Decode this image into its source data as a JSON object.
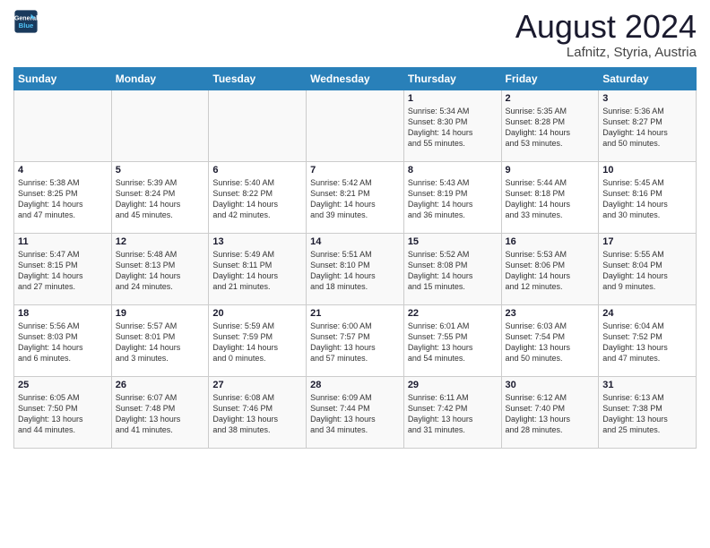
{
  "header": {
    "logo_line1": "General",
    "logo_line2": "Blue",
    "title": "August 2024",
    "subtitle": "Lafnitz, Styria, Austria"
  },
  "weekdays": [
    "Sunday",
    "Monday",
    "Tuesday",
    "Wednesday",
    "Thursday",
    "Friday",
    "Saturday"
  ],
  "weeks": [
    [
      {
        "day": "",
        "info": ""
      },
      {
        "day": "",
        "info": ""
      },
      {
        "day": "",
        "info": ""
      },
      {
        "day": "",
        "info": ""
      },
      {
        "day": "1",
        "info": "Sunrise: 5:34 AM\nSunset: 8:30 PM\nDaylight: 14 hours\nand 55 minutes."
      },
      {
        "day": "2",
        "info": "Sunrise: 5:35 AM\nSunset: 8:28 PM\nDaylight: 14 hours\nand 53 minutes."
      },
      {
        "day": "3",
        "info": "Sunrise: 5:36 AM\nSunset: 8:27 PM\nDaylight: 14 hours\nand 50 minutes."
      }
    ],
    [
      {
        "day": "4",
        "info": "Sunrise: 5:38 AM\nSunset: 8:25 PM\nDaylight: 14 hours\nand 47 minutes."
      },
      {
        "day": "5",
        "info": "Sunrise: 5:39 AM\nSunset: 8:24 PM\nDaylight: 14 hours\nand 45 minutes."
      },
      {
        "day": "6",
        "info": "Sunrise: 5:40 AM\nSunset: 8:22 PM\nDaylight: 14 hours\nand 42 minutes."
      },
      {
        "day": "7",
        "info": "Sunrise: 5:42 AM\nSunset: 8:21 PM\nDaylight: 14 hours\nand 39 minutes."
      },
      {
        "day": "8",
        "info": "Sunrise: 5:43 AM\nSunset: 8:19 PM\nDaylight: 14 hours\nand 36 minutes."
      },
      {
        "day": "9",
        "info": "Sunrise: 5:44 AM\nSunset: 8:18 PM\nDaylight: 14 hours\nand 33 minutes."
      },
      {
        "day": "10",
        "info": "Sunrise: 5:45 AM\nSunset: 8:16 PM\nDaylight: 14 hours\nand 30 minutes."
      }
    ],
    [
      {
        "day": "11",
        "info": "Sunrise: 5:47 AM\nSunset: 8:15 PM\nDaylight: 14 hours\nand 27 minutes."
      },
      {
        "day": "12",
        "info": "Sunrise: 5:48 AM\nSunset: 8:13 PM\nDaylight: 14 hours\nand 24 minutes."
      },
      {
        "day": "13",
        "info": "Sunrise: 5:49 AM\nSunset: 8:11 PM\nDaylight: 14 hours\nand 21 minutes."
      },
      {
        "day": "14",
        "info": "Sunrise: 5:51 AM\nSunset: 8:10 PM\nDaylight: 14 hours\nand 18 minutes."
      },
      {
        "day": "15",
        "info": "Sunrise: 5:52 AM\nSunset: 8:08 PM\nDaylight: 14 hours\nand 15 minutes."
      },
      {
        "day": "16",
        "info": "Sunrise: 5:53 AM\nSunset: 8:06 PM\nDaylight: 14 hours\nand 12 minutes."
      },
      {
        "day": "17",
        "info": "Sunrise: 5:55 AM\nSunset: 8:04 PM\nDaylight: 14 hours\nand 9 minutes."
      }
    ],
    [
      {
        "day": "18",
        "info": "Sunrise: 5:56 AM\nSunset: 8:03 PM\nDaylight: 14 hours\nand 6 minutes."
      },
      {
        "day": "19",
        "info": "Sunrise: 5:57 AM\nSunset: 8:01 PM\nDaylight: 14 hours\nand 3 minutes."
      },
      {
        "day": "20",
        "info": "Sunrise: 5:59 AM\nSunset: 7:59 PM\nDaylight: 14 hours\nand 0 minutes."
      },
      {
        "day": "21",
        "info": "Sunrise: 6:00 AM\nSunset: 7:57 PM\nDaylight: 13 hours\nand 57 minutes."
      },
      {
        "day": "22",
        "info": "Sunrise: 6:01 AM\nSunset: 7:55 PM\nDaylight: 13 hours\nand 54 minutes."
      },
      {
        "day": "23",
        "info": "Sunrise: 6:03 AM\nSunset: 7:54 PM\nDaylight: 13 hours\nand 50 minutes."
      },
      {
        "day": "24",
        "info": "Sunrise: 6:04 AM\nSunset: 7:52 PM\nDaylight: 13 hours\nand 47 minutes."
      }
    ],
    [
      {
        "day": "25",
        "info": "Sunrise: 6:05 AM\nSunset: 7:50 PM\nDaylight: 13 hours\nand 44 minutes."
      },
      {
        "day": "26",
        "info": "Sunrise: 6:07 AM\nSunset: 7:48 PM\nDaylight: 13 hours\nand 41 minutes."
      },
      {
        "day": "27",
        "info": "Sunrise: 6:08 AM\nSunset: 7:46 PM\nDaylight: 13 hours\nand 38 minutes."
      },
      {
        "day": "28",
        "info": "Sunrise: 6:09 AM\nSunset: 7:44 PM\nDaylight: 13 hours\nand 34 minutes."
      },
      {
        "day": "29",
        "info": "Sunrise: 6:11 AM\nSunset: 7:42 PM\nDaylight: 13 hours\nand 31 minutes."
      },
      {
        "day": "30",
        "info": "Sunrise: 6:12 AM\nSunset: 7:40 PM\nDaylight: 13 hours\nand 28 minutes."
      },
      {
        "day": "31",
        "info": "Sunrise: 6:13 AM\nSunset: 7:38 PM\nDaylight: 13 hours\nand 25 minutes."
      }
    ]
  ]
}
